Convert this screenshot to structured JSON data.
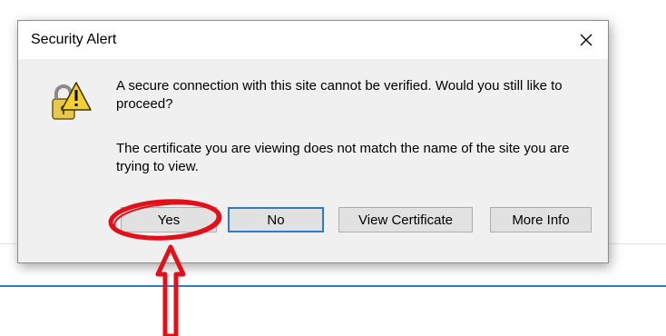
{
  "dialog": {
    "title": "Security Alert",
    "close_glyph": "✕",
    "icon": "security-lock-warning-icon",
    "message_1": "A secure connection with this site cannot be verified. Would you still like to proceed?",
    "message_2": "The certificate you are viewing does not match the name of the site you are trying to view.",
    "buttons": {
      "yes": "Yes",
      "no": "No",
      "view_certificate": "View Certificate",
      "more_info": "More Info"
    },
    "default_button": "No"
  },
  "annotation": {
    "color": "#e3101a",
    "circle_target": "Yes",
    "arrow_direction": "up"
  },
  "colors": {
    "accent_blue": "#2f7cc6",
    "dialog_bg": "#f0f0f0",
    "button_bg": "#e1e1e1"
  }
}
